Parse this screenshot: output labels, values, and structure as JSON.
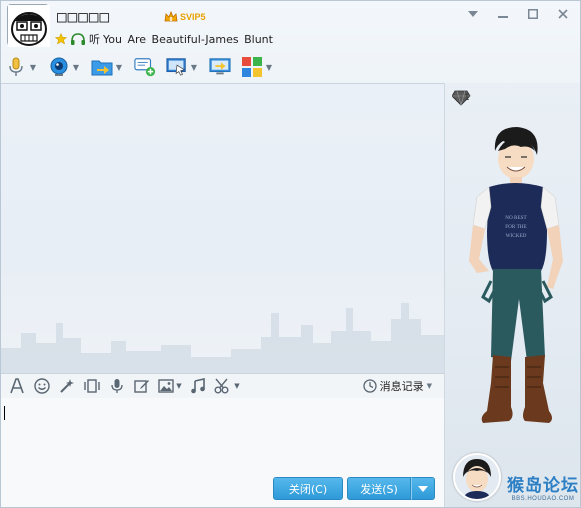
{
  "header": {
    "nickname": "□□□□□",
    "svip_label": "SVIP5",
    "listening_prefix": "听",
    "song": "You Are Beautiful-James Blunt"
  },
  "toolbar": {
    "items": [
      {
        "name": "voice-call",
        "icon": "microphone-icon",
        "has_dropdown": true
      },
      {
        "name": "video-call",
        "icon": "webcam-icon",
        "has_dropdown": true
      },
      {
        "name": "send-file",
        "icon": "folder-send-icon",
        "has_dropdown": true
      },
      {
        "name": "create-discussion",
        "icon": "chat-add-icon",
        "has_dropdown": false
      },
      {
        "name": "remote-assist",
        "icon": "remote-desktop-icon",
        "has_dropdown": true
      },
      {
        "name": "share-screen",
        "icon": "screen-share-icon",
        "has_dropdown": false
      },
      {
        "name": "apps",
        "icon": "apps-grid-icon",
        "has_dropdown": true
      }
    ]
  },
  "input_toolbar": {
    "message_record_label": "消息记录"
  },
  "buttons": {
    "close_label": "关闭(C)",
    "send_label": "发送(S)"
  },
  "right_panel": {
    "gem_count": "1",
    "shirt_text": "NO REST FOR THE WICKED"
  },
  "watermark": {
    "main": "猴岛论坛",
    "sub": "BBS.HOUDAO.COM"
  },
  "colors": {
    "accent": "#2e9ad8",
    "svip": "#e8a000",
    "background": "#eaf0f6"
  }
}
